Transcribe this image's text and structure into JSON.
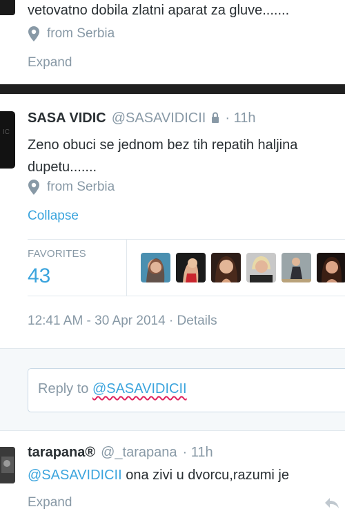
{
  "tweet_top": {
    "text": "vetovatno dobila zlatni  aparat za gluve.......",
    "location": "from Serbia",
    "expand": "Expand"
  },
  "tweet_main": {
    "name": "SASA VIDIC",
    "handle": "@SASAVIDICII",
    "time": "11h",
    "line1": "Zeno obuci se jednom bez tih repatih haljina",
    "line2": "dupetu.......",
    "location": "from Serbia",
    "collapse": "Collapse",
    "favorites_label": "FAVORITES",
    "favorites_count": "43",
    "timestamp": "12:41 AM - 30 Apr 2014",
    "details": "Details"
  },
  "reply": {
    "prefix": "Reply to ",
    "handle": "@SASAVIDICII"
  },
  "tweet_bottom": {
    "name": "tarapana®",
    "handle": "@_tarapana",
    "time": "11h",
    "mention": "@SASAVIDICII",
    "text": " ona zivi u dvorcu,razumi je",
    "expand": "Expand"
  },
  "colors": {
    "link": "#3ba4dd",
    "muted": "#8899a6",
    "text": "#292f33"
  }
}
